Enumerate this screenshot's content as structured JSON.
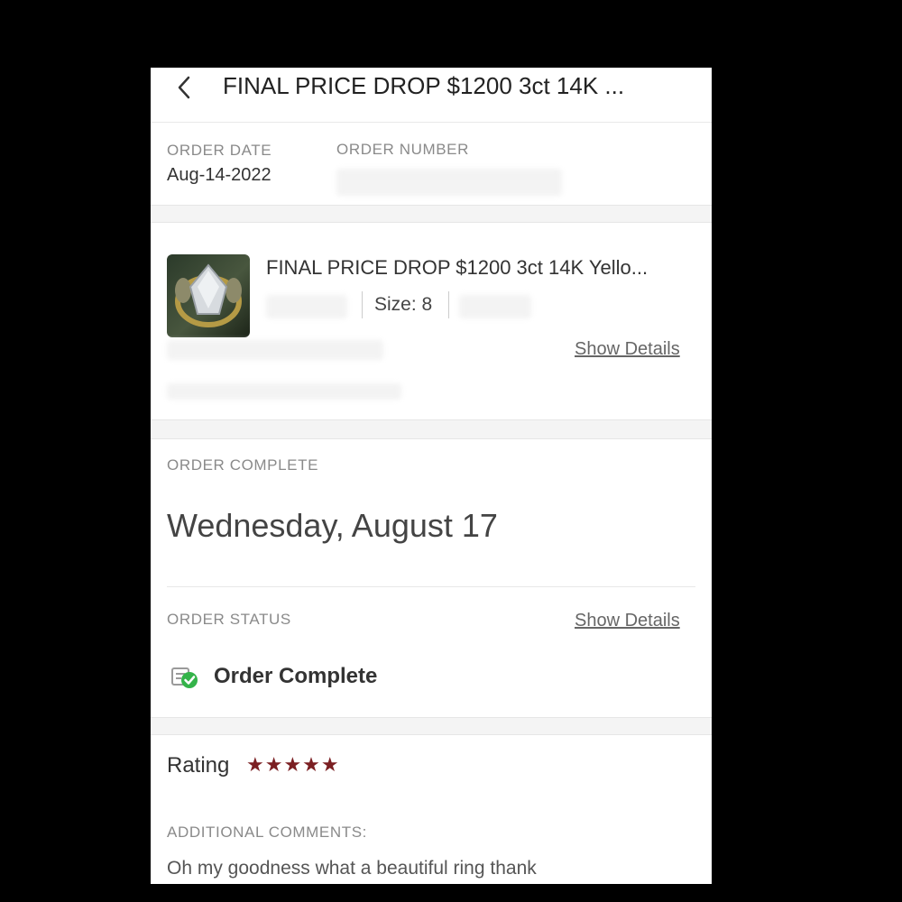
{
  "header": {
    "title": "FINAL PRICE DROP $1200 3ct 14K ...",
    "back_icon": "chevron-left-icon"
  },
  "order_info": {
    "date_label": "ORDER DATE",
    "date_value": "Aug-14-2022",
    "number_label": "ORDER NUMBER"
  },
  "item": {
    "title": "FINAL PRICE DROP $1200 3ct 14K Yello...",
    "size_text": "Size: 8",
    "show_details": "Show Details"
  },
  "completion": {
    "label": "ORDER COMPLETE",
    "date": "Wednesday, August 17"
  },
  "status": {
    "label": "ORDER STATUS",
    "show_details": "Show Details",
    "text": "Order Complete",
    "icon": "package-check-icon",
    "check_color": "#34b34a"
  },
  "rating": {
    "label": "Rating",
    "stars_text": "★★★★★",
    "value": 5,
    "max": 5,
    "star_color": "#7b1f22"
  },
  "comments": {
    "label": "ADDITIONAL COMMENTS:",
    "text": "Oh my goodness what a beautiful ring thank"
  }
}
